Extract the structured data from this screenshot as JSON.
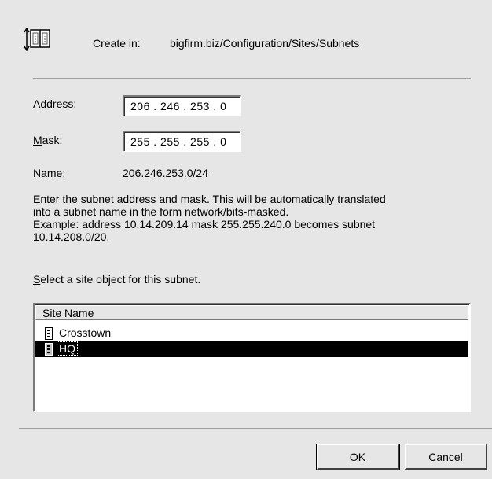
{
  "header": {
    "create_in_label": "Create in:",
    "create_in_path": "bigfirm.biz/Configuration/Sites/Subnets",
    "icon": "subnet-icon"
  },
  "address": {
    "label": "Address:",
    "value": "206 . 246 . 253 .  0"
  },
  "mask": {
    "label": "Mask:",
    "value": "255 . 255 . 255 .  0"
  },
  "name": {
    "label": "Name:",
    "value": "206.246.253.0/24"
  },
  "description": {
    "line1": "Enter the subnet address and mask. This will be automatically translated",
    "line2": "into a subnet name in the form network/bits-masked.",
    "line3": "Example: address 10.14.209.14 mask 255.255.240.0 becomes subnet",
    "line4": "10.14.208.0/20."
  },
  "site_prompt": "Select a site object for this subnet.",
  "site_list": {
    "column_header": "Site Name",
    "items": [
      {
        "label": "Crosstown",
        "selected": false,
        "icon": "site-icon"
      },
      {
        "label": "HQ",
        "selected": true,
        "icon": "site-icon"
      }
    ]
  },
  "buttons": {
    "ok": "OK",
    "cancel": "Cancel"
  },
  "colors": {
    "dialog_bg": "#e6e6e6",
    "selection_bg": "#000000",
    "selection_fg": "#ffffff"
  }
}
